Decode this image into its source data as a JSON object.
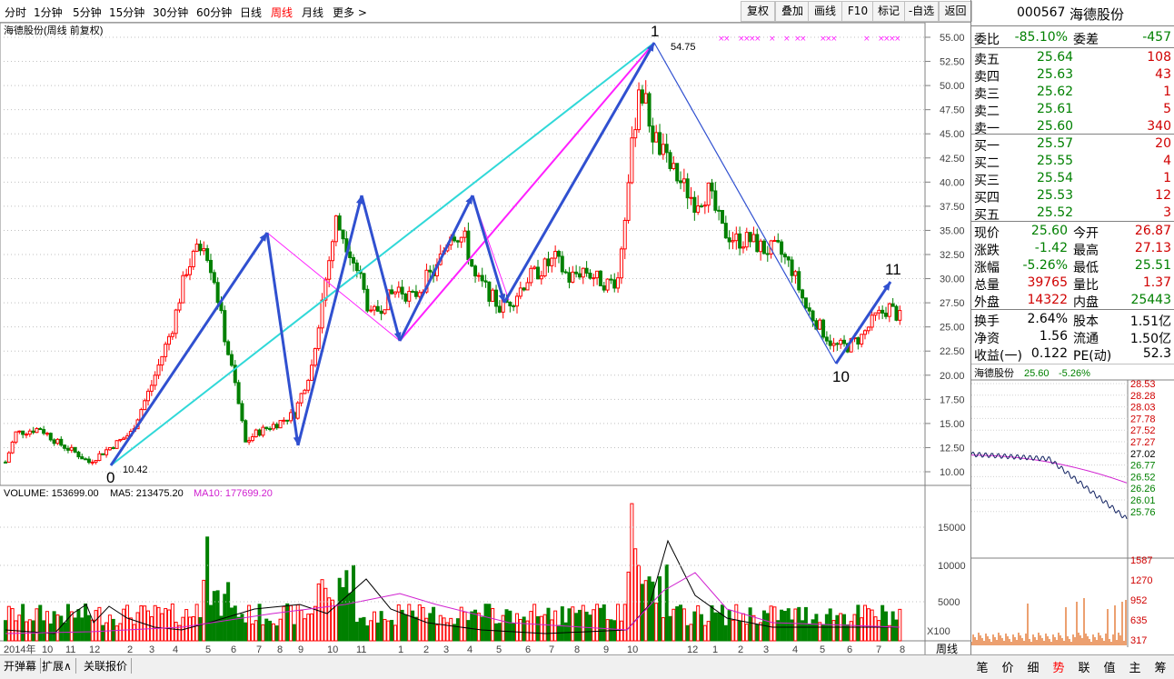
{
  "toolbar": {
    "periods": [
      "分时",
      "1分钟",
      "5分钟",
      "15分钟",
      "30分钟",
      "60分钟",
      "日线",
      "周线",
      "月线",
      "更多 >"
    ],
    "active_period": "周线",
    "right_buttons": [
      "复权",
      "叠加",
      "画线",
      "F10",
      "标记",
      "-自选",
      "返回"
    ]
  },
  "stock_code": "000567",
  "stock_name": "海德股份",
  "chart": {
    "caption": "海德股份(周线 前复权)",
    "y_ticks": [
      "55.00",
      "52.50",
      "50.00",
      "47.50",
      "45.00",
      "42.50",
      "40.00",
      "37.50",
      "35.00",
      "32.50",
      "30.00",
      "27.50",
      "25.00",
      "22.50",
      "20.00",
      "17.50",
      "15.00",
      "12.50",
      "10.00"
    ],
    "high_label": "54.75",
    "low_label": "10.42",
    "wave_labels": [
      "0",
      "1",
      "10",
      "11"
    ],
    "volume_line": "VOLUME: 153699.00",
    "ma5": "MA5: 213475.20",
    "ma10": "MA10: 177699.20",
    "vol_ticks": [
      "15000",
      "10000",
      "5000"
    ],
    "vol_unit": "X100",
    "x_labels": [
      "2014年",
      "10",
      "11",
      "12",
      "2",
      "3",
      "4",
      "5",
      "6",
      "7",
      "8",
      "9",
      "10",
      "11",
      "1",
      "2",
      "3",
      "4",
      "5",
      "6",
      "7",
      "8",
      "9",
      "10",
      "12",
      "1",
      "2",
      "3",
      "4",
      "5",
      "6",
      "7",
      "8"
    ],
    "period_label": "周线"
  },
  "quote": {
    "wb_label": "委比",
    "wb": "-85.10%",
    "wc_label": "委差",
    "wc": "-457",
    "asks": [
      {
        "label": "卖五",
        "price": "25.64",
        "vol": "108"
      },
      {
        "label": "卖四",
        "price": "25.63",
        "vol": "43"
      },
      {
        "label": "卖三",
        "price": "25.62",
        "vol": "1"
      },
      {
        "label": "卖二",
        "price": "25.61",
        "vol": "5"
      },
      {
        "label": "卖一",
        "price": "25.60",
        "vol": "340"
      }
    ],
    "bids": [
      {
        "label": "买一",
        "price": "25.57",
        "vol": "20"
      },
      {
        "label": "买二",
        "price": "25.55",
        "vol": "4"
      },
      {
        "label": "买三",
        "price": "25.54",
        "vol": "1"
      },
      {
        "label": "买四",
        "price": "25.53",
        "vol": "12"
      },
      {
        "label": "买五",
        "price": "25.52",
        "vol": "3"
      }
    ],
    "stats": [
      {
        "l1": "现价",
        "v1": "25.60",
        "l2": "今开",
        "v2": "26.87",
        "c1": "g",
        "c2": "r"
      },
      {
        "l1": "涨跌",
        "v1": "-1.42",
        "l2": "最高",
        "v2": "27.13",
        "c1": "g",
        "c2": "r"
      },
      {
        "l1": "涨幅",
        "v1": "-5.26%",
        "l2": "最低",
        "v2": "25.51",
        "c1": "g",
        "c2": "g"
      },
      {
        "l1": "总量",
        "v1": "39765",
        "l2": "量比",
        "v2": "1.37",
        "c1": "r",
        "c2": "r"
      },
      {
        "l1": "外盘",
        "v1": "14322",
        "l2": "内盘",
        "v2": "25443",
        "c1": "r",
        "c2": "g"
      }
    ],
    "info": [
      {
        "l1": "换手",
        "v1": "2.64%",
        "l2": "股本",
        "v2": "1.51亿"
      },
      {
        "l1": "净资",
        "v1": "1.56",
        "l2": "流通",
        "v2": "1.50亿"
      },
      {
        "l1": "收益(一)",
        "v1": "0.122",
        "l2": "PE(动)",
        "v2": "52.3"
      }
    ]
  },
  "mini": {
    "title": "海德股份",
    "price": "25.60",
    "change": "-5.26%",
    "ticks": [
      "28.53",
      "28.28",
      "28.03",
      "27.78",
      "27.52",
      "27.27",
      "27.02",
      "26.77",
      "26.52",
      "26.26",
      "26.01",
      "25.76"
    ],
    "vol_ticks": [
      "1587",
      "1270",
      "952",
      "635",
      "317"
    ]
  },
  "bottom_tabs": [
    "开弹幕",
    "扩展∧",
    "关联报价"
  ],
  "right_tabs": [
    "笔",
    "价",
    "细",
    "势",
    "联",
    "值",
    "主",
    "筹"
  ],
  "right_tab_active": "势",
  "colors": {
    "up": "#ff0000",
    "down": "#008000",
    "wave": "#3050d0",
    "cyan": "#30d8d8",
    "magenta": "#ff20ff",
    "ma5": "#000000",
    "ma10": "#d020d0"
  }
}
